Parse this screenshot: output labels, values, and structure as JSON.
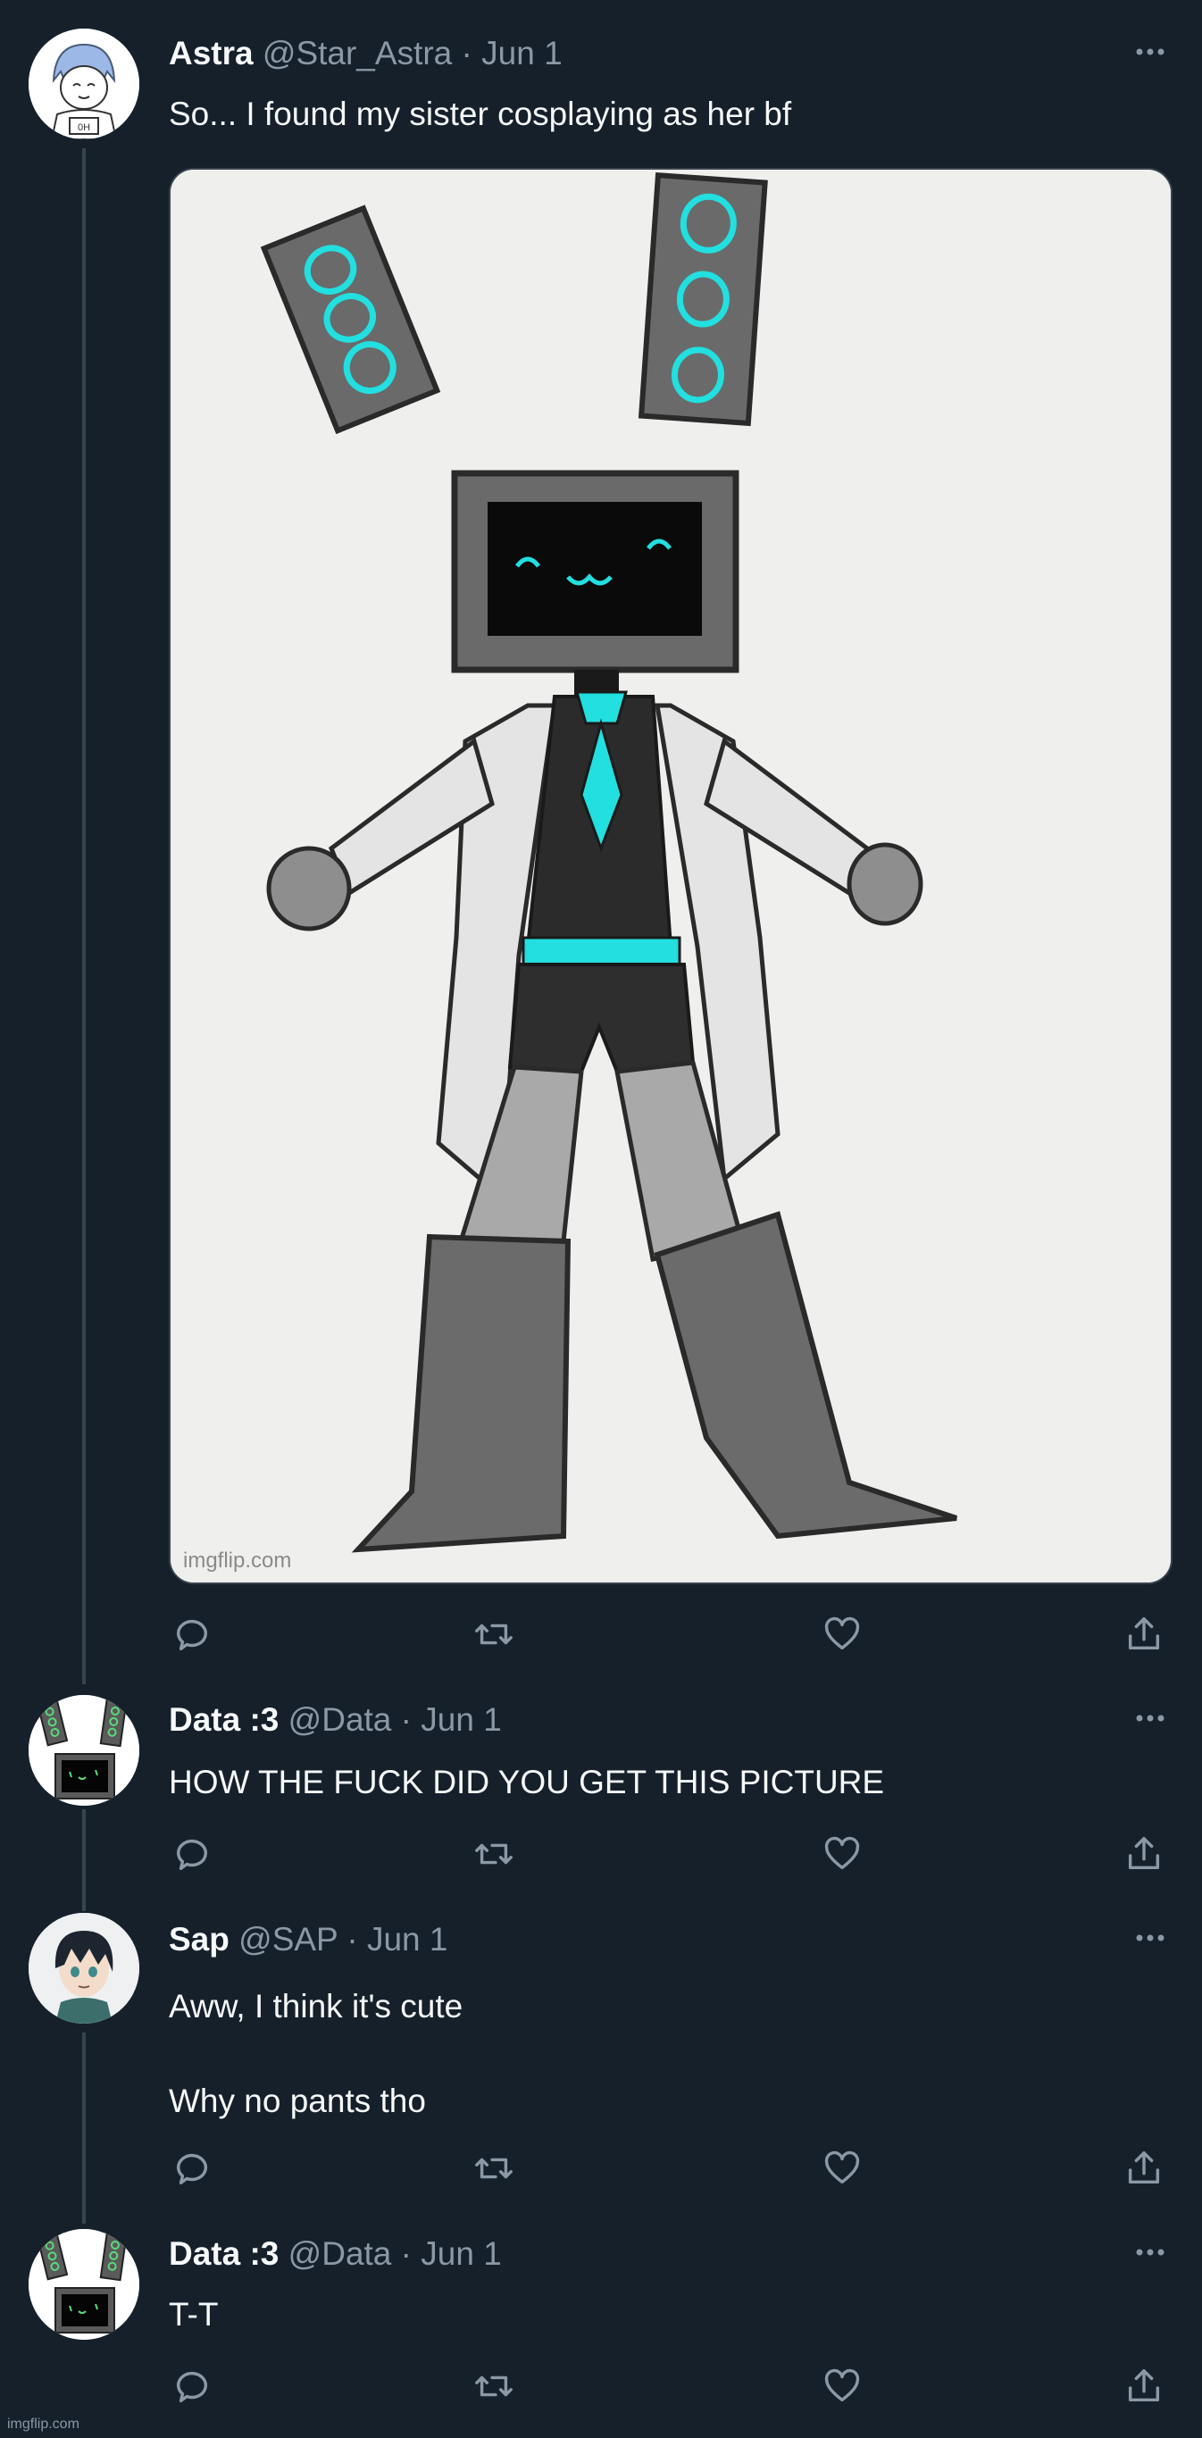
{
  "theme": {
    "background": "#15202b",
    "text": "#f7f9f9",
    "muted": "#8b98a5",
    "accent_cyan": "#22dfe0"
  },
  "tweets": [
    {
      "name": "Astra",
      "handle": "@Star_Astra",
      "separator": "·",
      "date": "Jun 1",
      "text": "So... I found my sister cosplaying as her bf",
      "avatar_icon": "robot-girl-avatar",
      "media": {
        "watermark": "imgflip.com",
        "description_icon": "robot-tv-head-drawing"
      }
    },
    {
      "name": "Data :3",
      "handle": "@Data",
      "separator": "·",
      "date": "Jun 1",
      "text": "HOW THE FUCK DID YOU GET THIS PICTURE",
      "avatar_icon": "tv-head-avatar"
    },
    {
      "name": "Sap",
      "handle": "@SAP",
      "separator": "·",
      "date": "Jun 1",
      "text": "Aww, I think it's cute\n\nWhy no pants tho",
      "avatar_icon": "anime-boy-avatar"
    },
    {
      "name": "Data :3",
      "handle": "@Data",
      "separator": "·",
      "date": "Jun 1",
      "text": "T-T",
      "avatar_icon": "tv-head-avatar"
    }
  ],
  "icons": [
    "more-icon",
    "reply-icon",
    "retweet-icon",
    "like-icon",
    "share-icon"
  ],
  "footer_watermark": "imgflip.com"
}
